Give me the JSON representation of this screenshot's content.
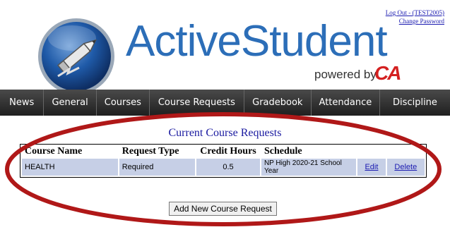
{
  "header": {
    "logout_link": "Log Out - (TEST2005)",
    "change_password_link": "Change Password"
  },
  "logo": {
    "title": "ActiveStudent",
    "powered_by": "powered by",
    "brand": "CA"
  },
  "nav": {
    "items": [
      "News",
      "General",
      "Courses",
      "Course Requests",
      "Gradebook",
      "Attendance",
      "Discipline"
    ]
  },
  "main": {
    "section_title": "Current Course Requests",
    "columns": [
      "Course Name",
      "Request Type",
      "Credit Hours",
      "Schedule"
    ],
    "rows": [
      {
        "course_name": "HEALTH",
        "request_type": "Required",
        "credit_hours": "0.5",
        "schedule": "NP High 2020-21 School Year",
        "edit": "Edit",
        "delete": "Delete"
      }
    ],
    "add_button": "Add New Course Request"
  },
  "colors": {
    "nav_bg": "#2a2a2a",
    "row_bg": "#c6cfe6",
    "title_blue": "#2c6eb8",
    "annotation_red": "#b01818",
    "brand_red": "#d42020"
  }
}
